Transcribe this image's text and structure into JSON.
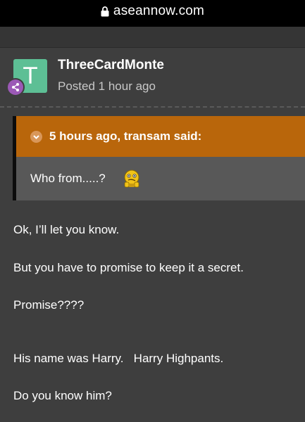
{
  "browser": {
    "url": "aseannow.com"
  },
  "post": {
    "avatar_letter": "T",
    "avatar_color": "#5dbf95",
    "badge_color": "#9b59b6",
    "author": "ThreeCardMonte",
    "posted": "Posted 1 hour ago"
  },
  "quote": {
    "citation": "5 hours ago, transam said:",
    "text": "Who from.....?",
    "emoji": "confused-face-emoji",
    "header_color": "#b9660b"
  },
  "body": {
    "paragraphs": [
      "Ok, I’ll let you know.",
      "But you have to promise to keep it a secret.",
      "Promise????",
      "His name was Harry.   Harry Highpants.",
      "Do you know him?"
    ]
  }
}
